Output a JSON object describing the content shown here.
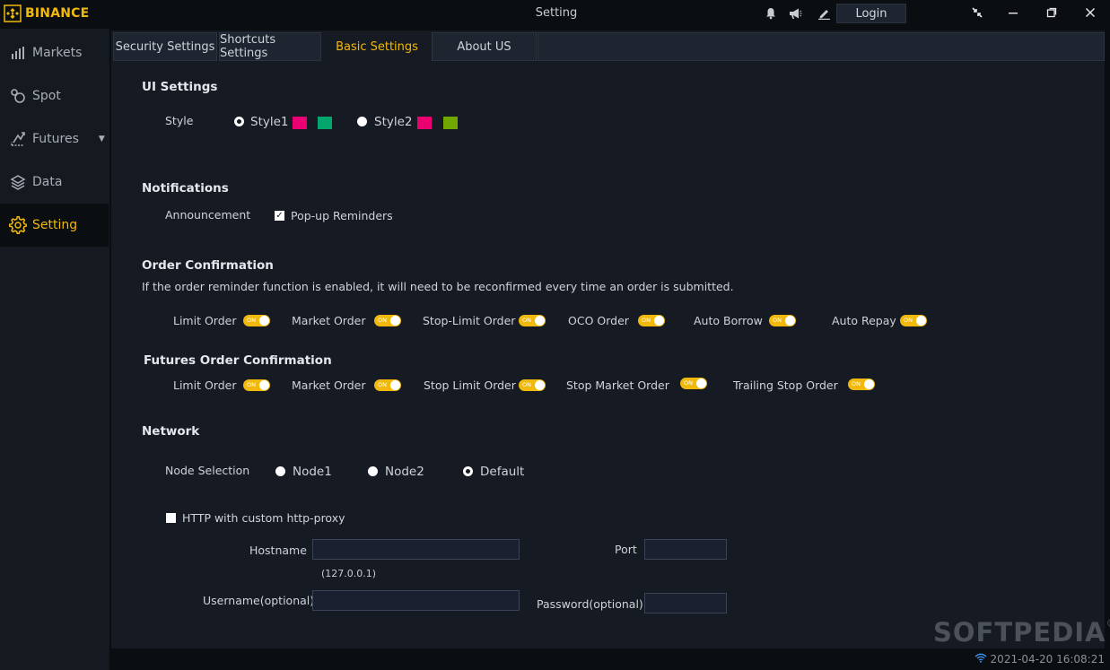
{
  "app": {
    "brand": "BINANCE",
    "window_title": "Setting",
    "login_label": "Login"
  },
  "sidebar": {
    "items": [
      {
        "label": "Markets",
        "icon": "bar-chart-icon"
      },
      {
        "label": "Spot",
        "icon": "spot-icon"
      },
      {
        "label": "Futures",
        "icon": "futures-icon"
      },
      {
        "label": "Data",
        "icon": "layers-icon"
      },
      {
        "label": "Setting",
        "icon": "gear-icon",
        "active": true
      }
    ]
  },
  "tabs": [
    {
      "label": "Security Settings"
    },
    {
      "label": "Shortcuts Settings"
    },
    {
      "label": "Basic Settings",
      "active": true
    },
    {
      "label": "About US"
    }
  ],
  "ui_settings": {
    "title": "UI Settings",
    "style_label": "Style",
    "style1": {
      "label": "Style1",
      "colors": [
        "#ea0070",
        "#03a66d"
      ],
      "selected": true
    },
    "style2": {
      "label": "Style2",
      "colors": [
        "#ea0070",
        "#70a800"
      ],
      "selected": false
    }
  },
  "notifications": {
    "title": "Notifications",
    "announcement_label": "Announcement",
    "popup_label": "Pop-up  Reminders",
    "popup_checked": true
  },
  "order_confirmation": {
    "title": "Order Confirmation",
    "description": "If the order reminder function is enabled, it will need to be reconfirmed every time an order is submitted.",
    "toggle_text": "ON",
    "items": [
      {
        "label": "Limit Order",
        "on": true
      },
      {
        "label": "Market Order",
        "on": true
      },
      {
        "label": "Stop-Limit Order",
        "on": true
      },
      {
        "label": "OCO Order",
        "on": true
      },
      {
        "label": "Auto Borrow",
        "on": true
      },
      {
        "label": "Auto Repay",
        "on": true
      }
    ]
  },
  "futures_order_confirmation": {
    "title": "Futures Order Confirmation",
    "items": [
      {
        "label": "Limit Order",
        "on": true
      },
      {
        "label": "Market Order",
        "on": true
      },
      {
        "label": "Stop Limit Order",
        "on": true
      },
      {
        "label": "Stop Market Order",
        "on": true
      },
      {
        "label": "Trailing Stop Order",
        "on": true
      }
    ]
  },
  "network": {
    "title": "Network",
    "node_selection_label": "Node Selection",
    "nodes": [
      {
        "label": "Node1",
        "selected": false
      },
      {
        "label": "Node2",
        "selected": false
      },
      {
        "label": "Default",
        "selected": true
      }
    ],
    "proxy_label": "HTTP with custom http-proxy",
    "proxy_checked": false,
    "hostname_label": "Hostname",
    "hostname_hint": "(127.0.0.1)",
    "port_label": "Port",
    "username_label": "Username(optional)",
    "password_label": "Password(optional)",
    "hostname_value": "",
    "port_value": "",
    "username_value": "",
    "password_value": ""
  },
  "status": {
    "datetime": "2021-04-20 16:08:21"
  },
  "watermark": "SOFTPEDIA",
  "colors": {
    "accent": "#f0b90b",
    "background": "#161a23",
    "sidebar": "#151a21"
  }
}
